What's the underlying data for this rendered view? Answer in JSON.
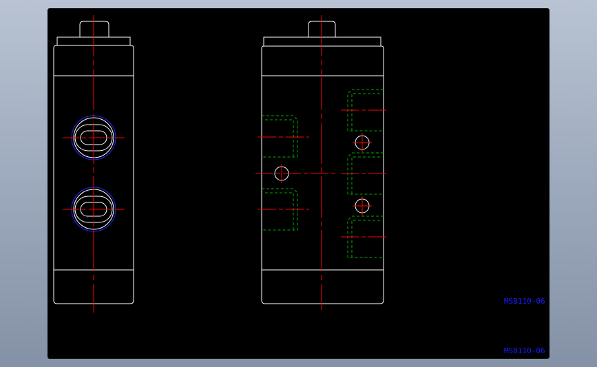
{
  "labels": {
    "part_number": "MSB110-06",
    "title_block": "MSB110-06"
  },
  "colors": {
    "background": "#000000",
    "outline": "#ffffff",
    "centerline": "#ff0000",
    "hidden": "#00aa00",
    "circle_blue": "#2222ff",
    "text": "#1a1aff"
  }
}
